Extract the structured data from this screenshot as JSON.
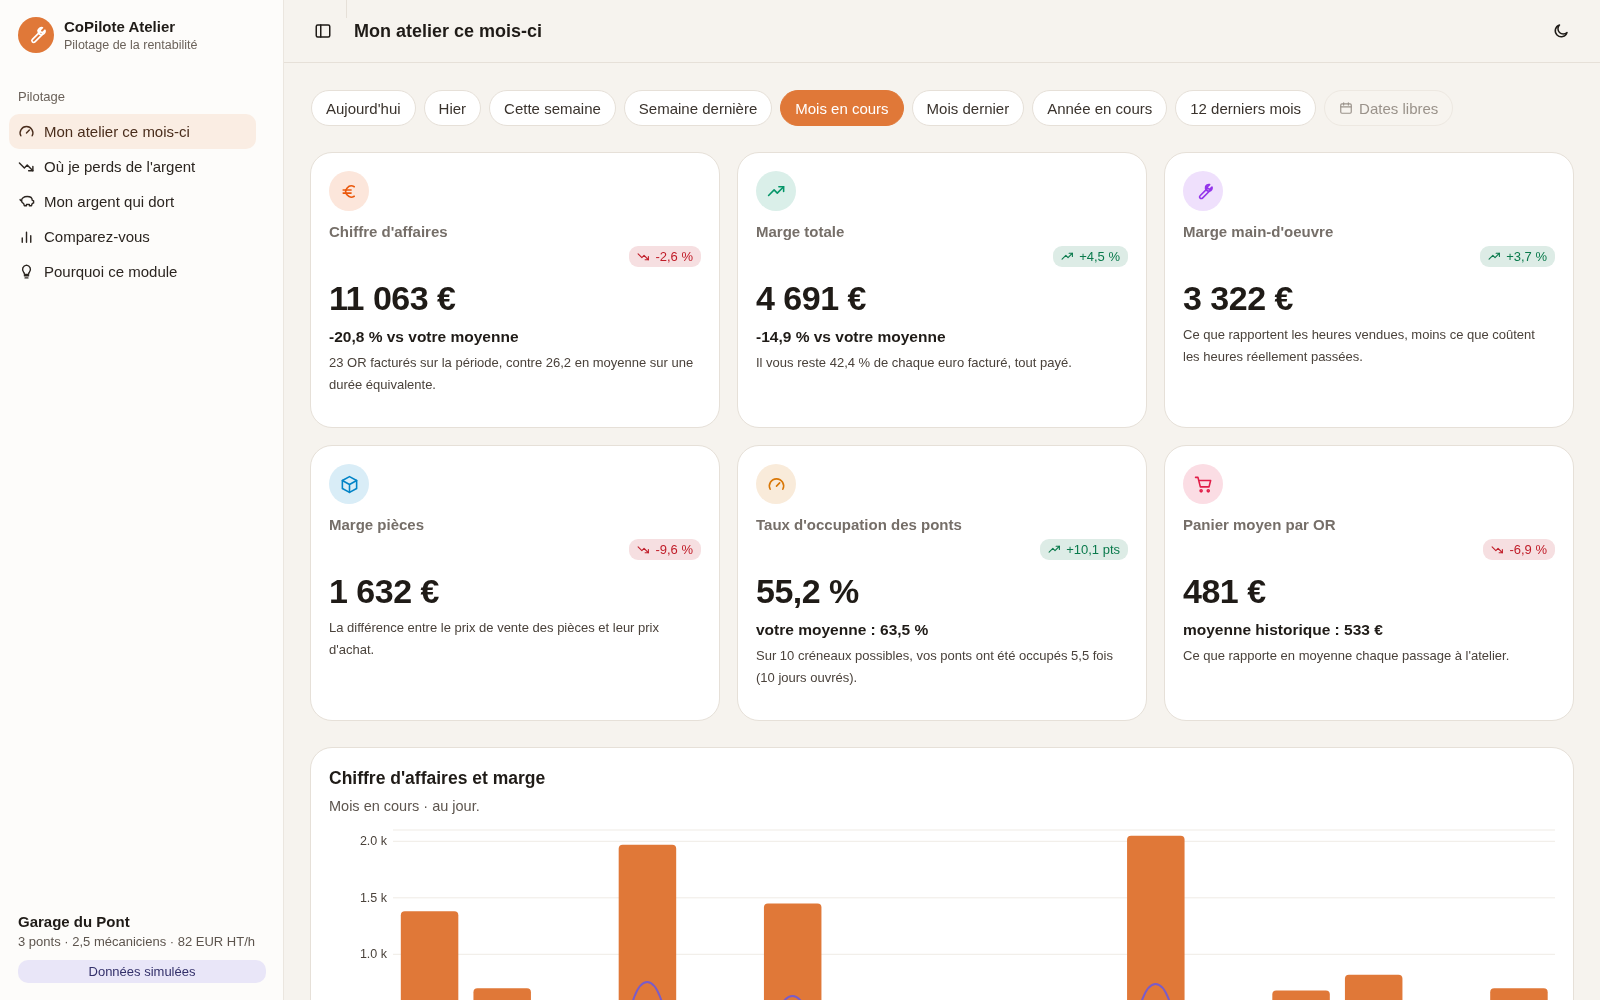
{
  "sidebar": {
    "app_name": "CoPilote Atelier",
    "app_subtitle": "Pilotage de la rentabilité",
    "section": "Pilotage",
    "items": [
      {
        "label": "Mon atelier ce mois-ci",
        "selected": true
      },
      {
        "label": "Où je perds de l'argent",
        "selected": false
      },
      {
        "label": "Mon argent qui dort",
        "selected": false
      },
      {
        "label": "Comparez-vous",
        "selected": false
      },
      {
        "label": "Pourquoi ce module",
        "selected": false
      }
    ],
    "garage": {
      "name": "Garage du Pont",
      "details": "3 ponts · 2,5 mécaniciens · 82 EUR HT/h",
      "badge": "Données simulées"
    }
  },
  "header": {
    "title": "Mon atelier ce mois-ci"
  },
  "periods": [
    {
      "label": "Aujourd'hui",
      "selected": false
    },
    {
      "label": "Hier",
      "selected": false
    },
    {
      "label": "Cette semaine",
      "selected": false
    },
    {
      "label": "Semaine dernière",
      "selected": false
    },
    {
      "label": "Mois en cours",
      "selected": true
    },
    {
      "label": "Mois dernier",
      "selected": false
    },
    {
      "label": "Année en cours",
      "selected": false
    },
    {
      "label": "12 derniers mois",
      "selected": false
    }
  ],
  "custom_dates": {
    "label": "Dates libres",
    "disabled": true
  },
  "kpis": [
    {
      "color": "#ea580c",
      "label": "Chiffre d'affaires",
      "change": {
        "kind": "down",
        "label": "-2,6 %",
        "color": "#c01c28"
      },
      "value": "11 063 €",
      "comparison": "-20,8 % vs votre moyenne",
      "note": "23 OR facturés sur la période, contre 26,2 en moyenne sur une durée équivalente."
    },
    {
      "color": "#059669",
      "label": "Marge totale",
      "change": {
        "kind": "up",
        "label": "+4,5 %",
        "color": "#0a7a4c"
      },
      "value": "4 691 €",
      "comparison": "-14,9 % vs votre moyenne",
      "note": "Il vous reste 42,4 % de chaque euro facturé, tout payé."
    },
    {
      "color": "#9333ea",
      "label": "Marge main-d'oeuvre",
      "change": {
        "kind": "up",
        "label": "+3,7 %",
        "color": "#0a7a4c"
      },
      "value": "3 322 €",
      "note": "Ce que rapportent les heures vendues, moins ce que coûtent les heures réellement passées."
    },
    {
      "color": "#0284c7",
      "label": "Marge pièces",
      "change": {
        "kind": "down",
        "label": "-9,6 %",
        "color": "#c01c28"
      },
      "value": "1 632 €",
      "note": "La différence entre le prix de vente des pièces et leur prix d'achat."
    },
    {
      "color": "#d97706",
      "label": "Taux d'occupation des ponts",
      "change": {
        "kind": "up",
        "label": "+10,1 pts",
        "color": "#0a7a4c"
      },
      "value": "55,2 %",
      "comparison": "votre moyenne : 63,5 %",
      "note": "Sur 10 créneaux possibles, vos ponts ont été occupés 5,5 fois (10 jours ouvrés)."
    },
    {
      "color": "#e11d48",
      "label": "Panier moyen par OR",
      "change": {
        "kind": "down",
        "label": "-6,9 %",
        "color": "#c01c28"
      },
      "value": "481 €",
      "comparison": "moyenne historique : 533 €",
      "note": "Ce que rapporte en moyenne chaque passage à l'atelier."
    }
  ],
  "chart": {
    "title": "Chiffre d'affaires et marge",
    "subtitle": "Mois en cours · au jour.",
    "revenue": {
      "chart_data": {
        "type": "bar",
        "grid": true,
        "ylim": [
          0,
          2100
        ],
        "yticks": [
          {
            "value": 1000,
            "label": "1.0 k"
          },
          {
            "value": 1500,
            "label": "1.5 k"
          },
          {
            "value": 2000,
            "label": "2.0 k"
          }
        ],
        "series": [
          {
            "color": "#e07838",
            "values": [
              1380,
              700,
              0,
              1970,
              0,
              1450,
              0,
              0,
              0,
              0,
              2050,
              0,
              680,
              820,
              0,
              700
            ]
          }
        ]
      }
    }
  }
}
